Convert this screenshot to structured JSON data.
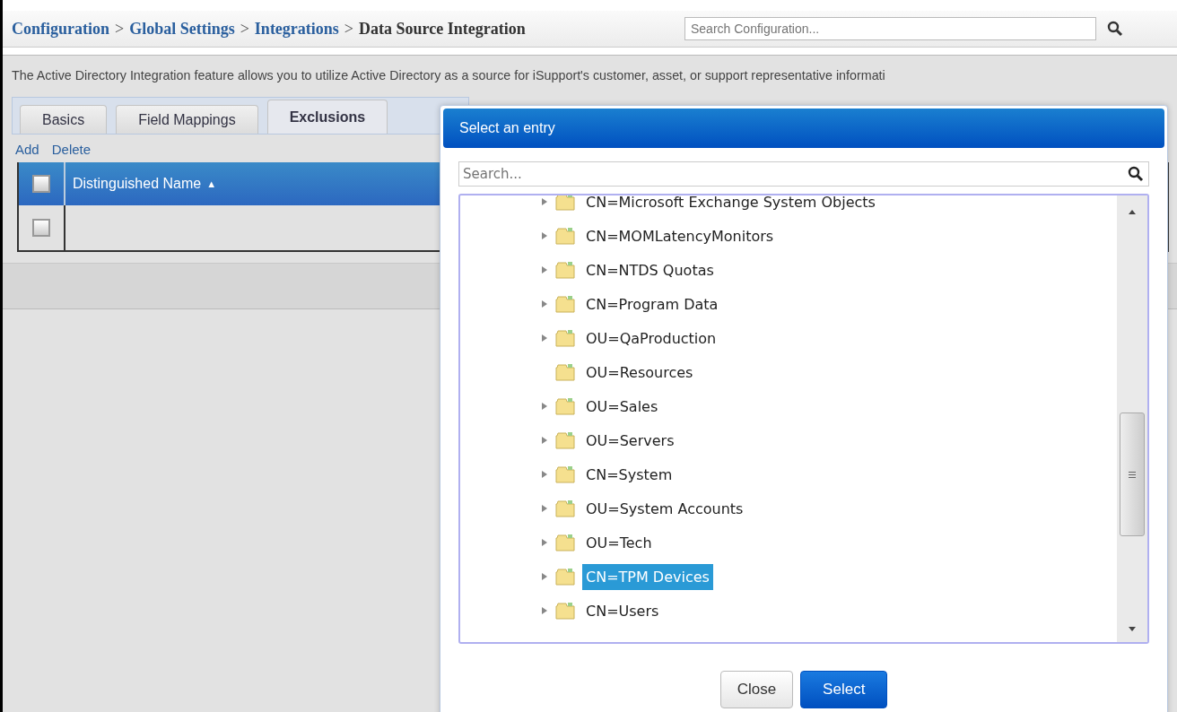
{
  "breadcrumb": [
    {
      "kind": "link",
      "label": "Configuration"
    },
    {
      "kind": "separator",
      "label": ">"
    },
    {
      "kind": "link",
      "label": "Global Settings"
    },
    {
      "kind": "separator",
      "label": ">"
    },
    {
      "kind": "link",
      "label": "Integrations"
    },
    {
      "kind": "separator",
      "label": ">"
    },
    {
      "kind": "current",
      "label": "Data Source Integration"
    }
  ],
  "config_search": {
    "placeholder": "Search Configuration..."
  },
  "intro": "The Active Directory Integration feature allows you to utilize Active Directory as a source for iSupport's customer, asset, or support representative informati",
  "tabs": [
    {
      "label": "Basics",
      "selected": false
    },
    {
      "label": "Field Mappings",
      "selected": false
    },
    {
      "label": "Exclusions",
      "selected": true
    }
  ],
  "actions": [
    "Add",
    "Delete"
  ],
  "table": {
    "header_checked": false,
    "columns": [
      {
        "label": "Distinguished Name",
        "sort": "▲"
      }
    ],
    "rows": [
      {
        "checked": false
      }
    ]
  },
  "dialog": {
    "title": "Select an entry",
    "search": {
      "placeholder": "Search..."
    },
    "tree": [
      {
        "label": "CN=Microsoft Exchange System Objects",
        "expandable": true,
        "selected": false
      },
      {
        "label": "CN=MOMLatencyMonitors",
        "expandable": true,
        "selected": false
      },
      {
        "label": "CN=NTDS Quotas",
        "expandable": true,
        "selected": false
      },
      {
        "label": "CN=Program Data",
        "expandable": true,
        "selected": false
      },
      {
        "label": "OU=QaProduction",
        "expandable": true,
        "selected": false
      },
      {
        "label": "OU=Resources",
        "expandable": false,
        "selected": false
      },
      {
        "label": "OU=Sales",
        "expandable": true,
        "selected": false
      },
      {
        "label": "OU=Servers",
        "expandable": true,
        "selected": false
      },
      {
        "label": "CN=System",
        "expandable": true,
        "selected": false
      },
      {
        "label": "OU=System Accounts",
        "expandable": true,
        "selected": false
      },
      {
        "label": "OU=Tech",
        "expandable": true,
        "selected": false
      },
      {
        "label": "CN=TPM Devices",
        "expandable": true,
        "selected": true
      },
      {
        "label": "CN=Users",
        "expandable": true,
        "selected": false
      }
    ],
    "buttons": [
      {
        "label": "Close",
        "kind": "secondary"
      },
      {
        "label": "Select",
        "kind": "primary"
      }
    ]
  }
}
